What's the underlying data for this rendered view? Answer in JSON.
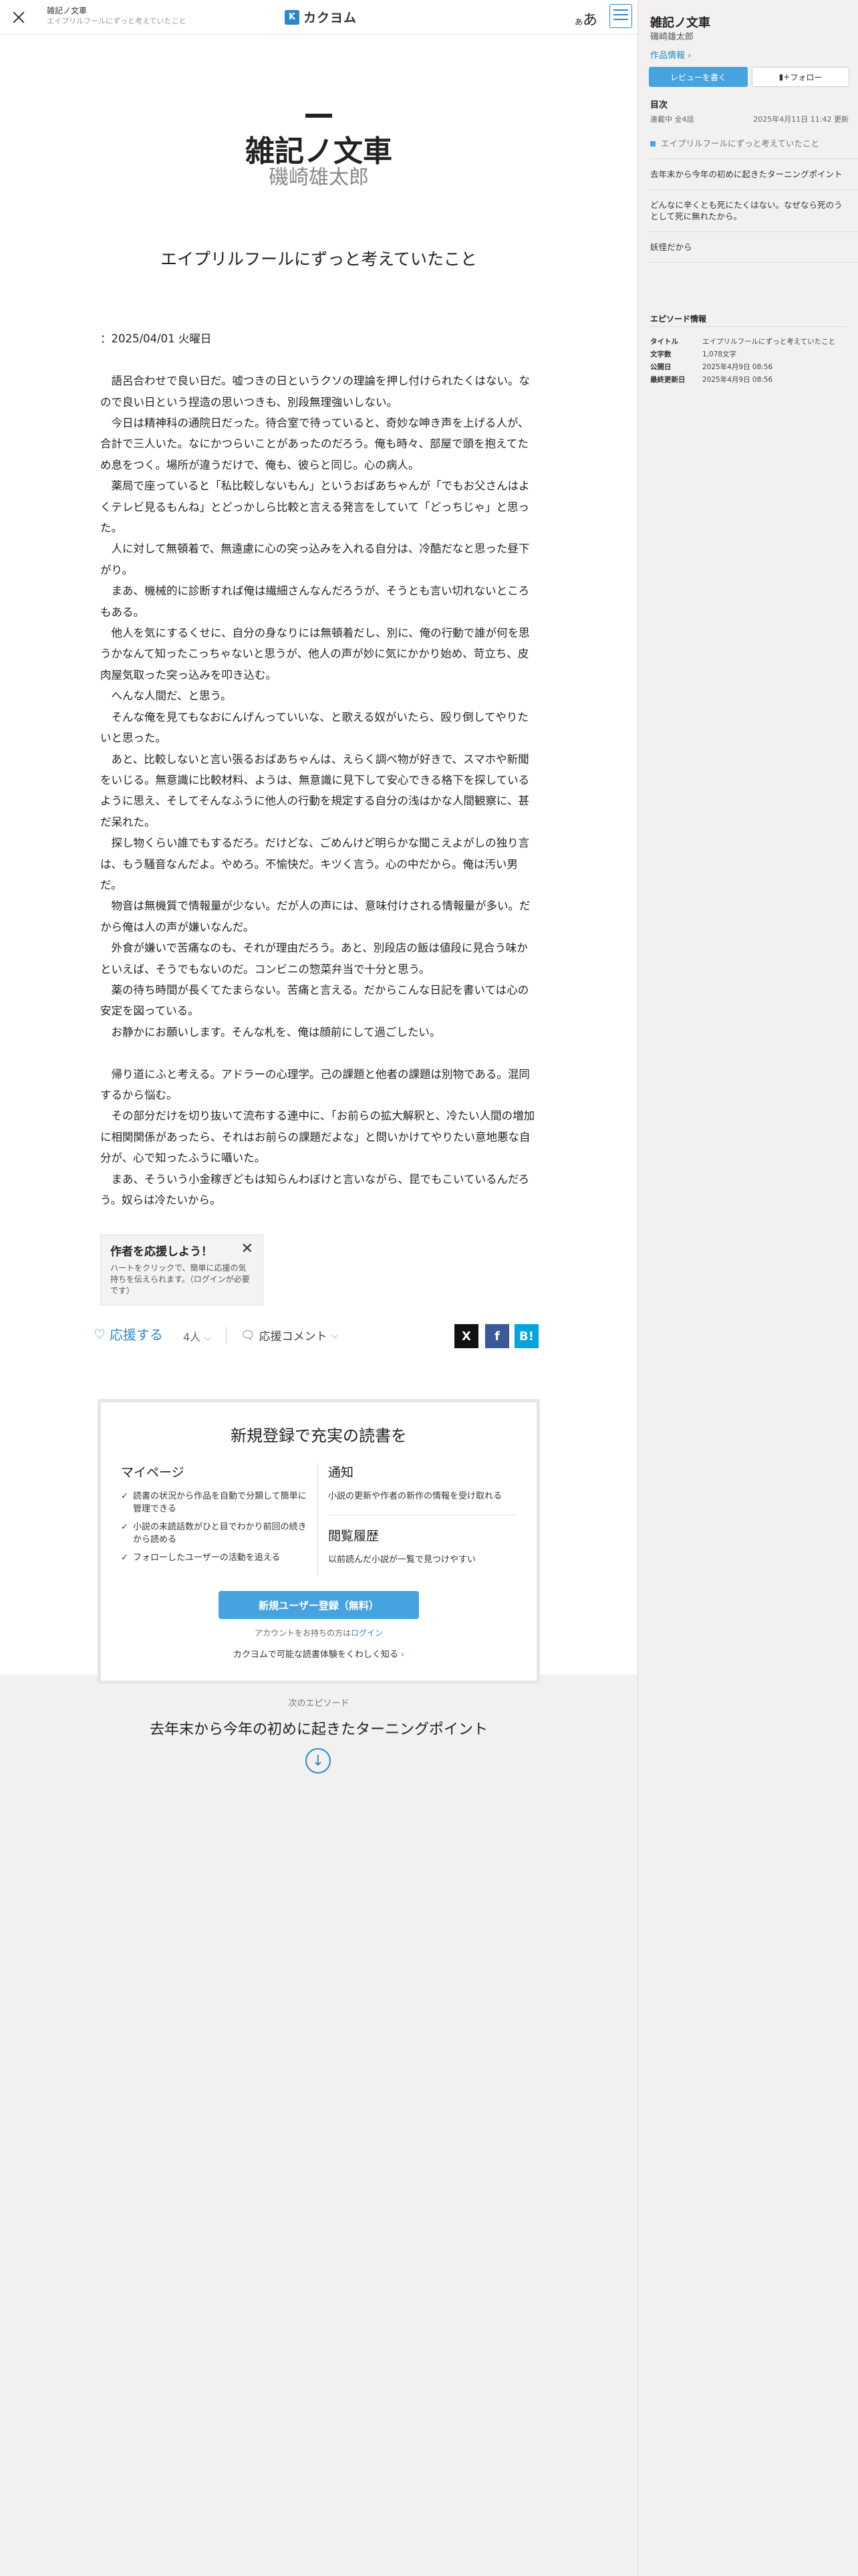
{
  "header": {
    "work_title": "雑記ノ文車",
    "episode_title": "エイプリルフールにずっと考えていたこと",
    "logo": "カクヨム",
    "logo_mark": "K",
    "font_button": "あ",
    "font_button_small": "あ"
  },
  "work": {
    "title": "雑記ノ文車",
    "author": "磯崎雄太郎"
  },
  "episode": {
    "title": "エイプリルフールにずっと考えていたこと",
    "paragraphs": [
      "",
      "：2025/04/01 火曜日",
      "",
      "　語呂合わせで良い日だ。嘘つきの日というクソの理論を押し付けられたくはない。なので良い日という捏造の思いつきも、別段無理強いしない。",
      "　今日は精神科の通院日だった。待合室で待っていると、奇妙な呻き声を上げる人が、合計で三人いた。なにかつらいことがあったのだろう。俺も時々、部屋で頭を抱えてため息をつく。場所が違うだけで、俺も、彼らと同じ。心の病人。",
      "　薬局で座っていると「私比較しないもん」というおばあちゃんが「でもお父さんはよくテレビ見るもんね」とどっかしら比較と言える発言をしていて「どっちじゃ」と思った。",
      "　人に対して無頓着で、無遠慮に心の突っ込みを入れる自分は、冷酷だなと思った昼下がり。",
      "　まあ、機械的に診断すれば俺は繊細さんなんだろうが、そうとも言い切れないところもある。",
      "　他人を気にするくせに、自分の身なりには無頓着だし、別に、俺の行動で誰が何を思うかなんて知ったこっちゃないと思うが、他人の声が妙に気にかかり始め、苛立ち、皮肉屋気取った突っ込みを叩き込む。",
      "　へんな人間だ、と思う。",
      "　そんな俺を見てもなおにんげんっていいな、と歌える奴がいたら、殴り倒してやりたいと思った。",
      "　あと、比較しないと言い張るおばあちゃんは、えらく調べ物が好きで、スマホや新聞をいじる。無意識に比較材料、ようは、無意識に見下して安心できる格下を探しているように思え、そしてそんなふうに他人の行動を規定する自分の浅はかな人間観察に、甚だ呆れた。",
      "　探し物くらい誰でもするだろ。だけどな、ごめんけど明らかな聞こえよがしの独り言は、もう騒音なんだよ。やめろ。不愉快だ。キツく言う。心の中だから。俺は汚い男だ。",
      "　物音は無機質で情報量が少ない。だが人の声には、意味付けされる情報量が多い。だから俺は人の声が嫌いなんだ。",
      "　外食が嫌いで苦痛なのも、それが理由だろう。あと、別段店の飯は値段に見合う味かといえば、そうでもないのだ。コンビニの惣菜弁当で十分と思う。",
      "　薬の待ち時間が長くてたまらない。苦痛と言える。だからこんな日記を書いては心の安定を図っている。",
      "　お静かにお願いします。そんな札を、俺は顔前にして過ごしたい。",
      "",
      "　帰り道にふと考える。アドラーの心理学。己の課題と他者の課題は別物である。混同するから悩む。",
      "　その部分だけを切り抜いて流布する連中に、「お前らの拡大解釈と、冷たい人間の増加に相関関係があったら、それはお前らの課題だよな」と問いかけてやりたい意地悪な自分が、心で知ったふうに囁いた。",
      "　まあ、そういう小金稼ぎどもは知らんわぼけと言いながら、昆でもこいているんだろう。奴らは冷たいから。"
    ]
  },
  "support_tip": {
    "title": "作者を応援しよう！",
    "close": "✕",
    "body": "ハートをクリックで、簡単に応援の気持ちを伝えられます。（ログインが必要です）"
  },
  "support_bar": {
    "heart_icon": "heart-icon",
    "support_label": "応援する",
    "support_count": "4人",
    "comment_label": "応援コメント",
    "share_x": "X",
    "share_facebook": "f",
    "share_hatena": "B!"
  },
  "signup": {
    "title": "新規登録で充実の読書を",
    "left_head": "マイページ",
    "features": [
      "読書の状況から作品を自動で分類して簡単に管理できる",
      "小説の未読話数がひと目でわかり前回の続きから読める",
      "フォローしたユーザーの活動を追える"
    ],
    "right_head_1": "通知",
    "right_desc_1": "小説の更新や作者の新作の情報を受け取れる",
    "right_head_2": "閲覧履歴",
    "right_desc_2": "以前読んだ小説が一覧で見つけやすい",
    "button": "新規ユーザー登録（無料）",
    "login_prefix": "アカウントをお持ちの方は",
    "login_link": "ログイン",
    "more_link": "カクヨムで可能な読書体験をくわしく知る"
  },
  "next_episode": {
    "label": "次のエピソード",
    "title": "去年末から今年の初めに起きたターニングポイント",
    "arrow": "↓"
  },
  "sidebar": {
    "title": "雑記ノ文車",
    "author": "磯崎雄太郎",
    "work_info": "作品情報",
    "review_button": "レビューを書く",
    "follow_button": "フォロー",
    "toc_head": "目次",
    "status": "連載中 全4話",
    "updated": "2025年4月11日 11:42 更新",
    "toc": [
      "エイプリルフールにずっと考えていたこと",
      "去年末から今年の初めに起きたターニングポイント",
      "どんなに辛くとも死にたくはない。なぜなら死のうとして死に無れたから。",
      "妖怪だから"
    ],
    "episode_info_head": "エピソード情報",
    "episode_info": [
      {
        "k": "タイトル",
        "v": "エイプリルフールにずっと考えていたこと"
      },
      {
        "k": "文字数",
        "v": "1,078文字"
      },
      {
        "k": "公開日",
        "v": "2025年4月9日 08:56"
      },
      {
        "k": "最終更新日",
        "v": "2025年4月9日 08:56"
      }
    ]
  },
  "colors": {
    "accent": "#2a87c9",
    "button_blue": "#47a3e0",
    "page_bg": "#f2f1ef",
    "paper": "#ffffff"
  }
}
